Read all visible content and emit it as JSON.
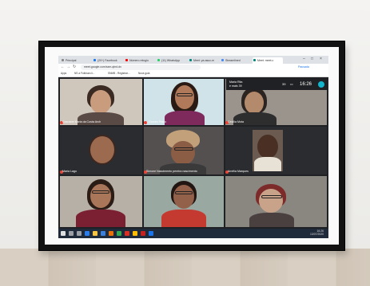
{
  "browser": {
    "tabs": [
      {
        "label": "Principal",
        "color": "#888888"
      },
      {
        "label": "(20+) Facebook",
        "color": "#1877f2"
      },
      {
        "label": "Número relogio",
        "color": "#ff0000"
      },
      {
        "label": "(11) WhatsApp",
        "color": "#25d366"
      },
      {
        "label": "Meet: ya-asuc-m",
        "color": "#00897b"
      },
      {
        "label": "Streamlined",
        "color": "#4a8af4"
      },
      {
        "label": "Meet: meet.c",
        "color": "#00897b"
      }
    ],
    "url": "meet.google.com/sxm-qbvt-dx",
    "profile_label": "Pausada",
    "bookmarks": [
      "Apps",
      "NS a Folkbura li...",
      "SNMB - Registrar...",
      "Nova guia"
    ]
  },
  "meet": {
    "meeting_title": "Maria Rita",
    "meeting_subtitle": "e mais 39",
    "participant_count": "39",
    "time": "16:26",
    "participants": [
      {
        "name": "Graciane Maria da Costa Arch"
      },
      {
        "name": "...Gomes Prado"
      },
      {
        "name": "Cecília Mota"
      },
      {
        "name": ""
      },
      {
        "name": "Maria Lago"
      },
      {
        "name": "Simone Nascimento pereira nascimento"
      },
      {
        "name": "Amélia Marques"
      },
      {
        "name": ""
      },
      {
        "name": ""
      },
      {
        "name": ""
      }
    ]
  },
  "taskbar": {
    "time": "16:26",
    "date": "13/07/2020"
  },
  "colors": {
    "frame": "#121212",
    "mat": "#fafafa",
    "meet_bg": "#202124",
    "mic_off": "#ea4335",
    "taskbar": "#1f2a3a"
  }
}
